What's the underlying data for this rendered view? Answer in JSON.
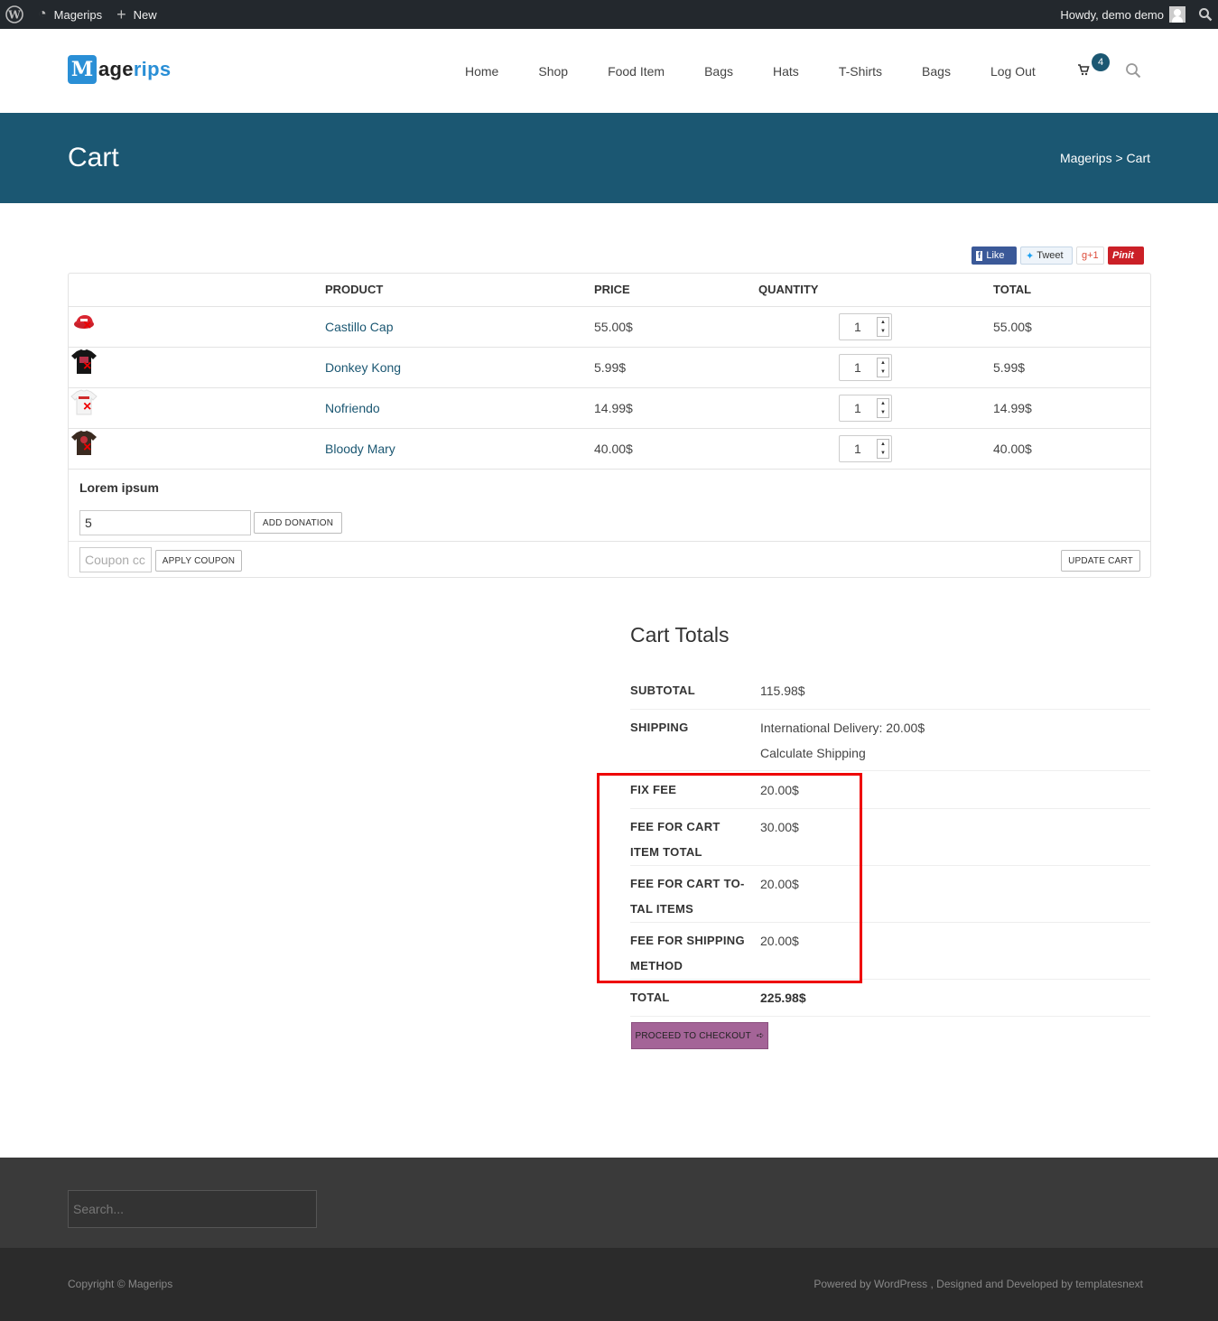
{
  "adminbar": {
    "site_name": "Magerips",
    "new_label": "New",
    "howdy": "Howdy, demo demo"
  },
  "logo": {
    "mark": "M",
    "text_dark": "age",
    "text_blue": "rips"
  },
  "nav": [
    "Home",
    "Shop",
    "Food Item",
    "Bags",
    "Hats",
    "T-Shirts",
    "Bags",
    "Log Out"
  ],
  "cart_count": "4",
  "page": {
    "title": "Cart",
    "breadcrumb": "Magerips > Cart"
  },
  "social": {
    "like": "Like",
    "tweet": "Tweet",
    "gplus": "g+1",
    "pinit": "Pinit"
  },
  "table": {
    "headers": {
      "product": "PRODUCT",
      "price": "PRICE",
      "quantity": "QUANTITY",
      "total": "TOTAL"
    },
    "rows": [
      {
        "name": "Castillo Cap",
        "price": "55.00$",
        "qty": "1",
        "total": "55.00$"
      },
      {
        "name": "Donkey Kong",
        "price": "5.99$",
        "qty": "1",
        "total": "5.99$"
      },
      {
        "name": "Nofriendo",
        "price": "14.99$",
        "qty": "1",
        "total": "14.99$"
      },
      {
        "name": "Bloody Mary",
        "price": "40.00$",
        "qty": "1",
        "total": "40.00$"
      }
    ]
  },
  "donation": {
    "label": "Lorem ipsum",
    "value": "5",
    "button": "ADD DONATION"
  },
  "coupon": {
    "placeholder": "Coupon cc",
    "apply": "APPLY COUPON",
    "update": "UPDATE CART"
  },
  "totals": {
    "title": "Cart Totals",
    "subtotal_label": "SUBTOTAL",
    "subtotal": "115.98$",
    "shipping_label": "SHIPPING",
    "shipping": "International Delivery: 20.00$",
    "calc_shipping": "Calculate Shipping",
    "fees": [
      {
        "label": "FIX FEE",
        "value": "20.00$"
      },
      {
        "label": "FEE FOR CART ITEM TOTAL",
        "value": "30.00$"
      },
      {
        "label": "FEE FOR CART TO-TAL ITEMS",
        "value": "20.00$"
      },
      {
        "label": "FEE FOR SHIPPING METHOD",
        "value": "20.00$"
      }
    ],
    "total_label": "TOTAL",
    "total": "225.98$",
    "checkout": "PROCEED TO CHECKOUT"
  },
  "footer": {
    "search_placeholder": "Search...",
    "copyright": "Copyright © Magerips",
    "powered": "Powered by WordPress , Designed and Developed by templatesnext"
  },
  "colors": {
    "brand": "#1b5772",
    "checkout": "#a46497",
    "remove": "#e00000",
    "highlight": "#e00000"
  }
}
